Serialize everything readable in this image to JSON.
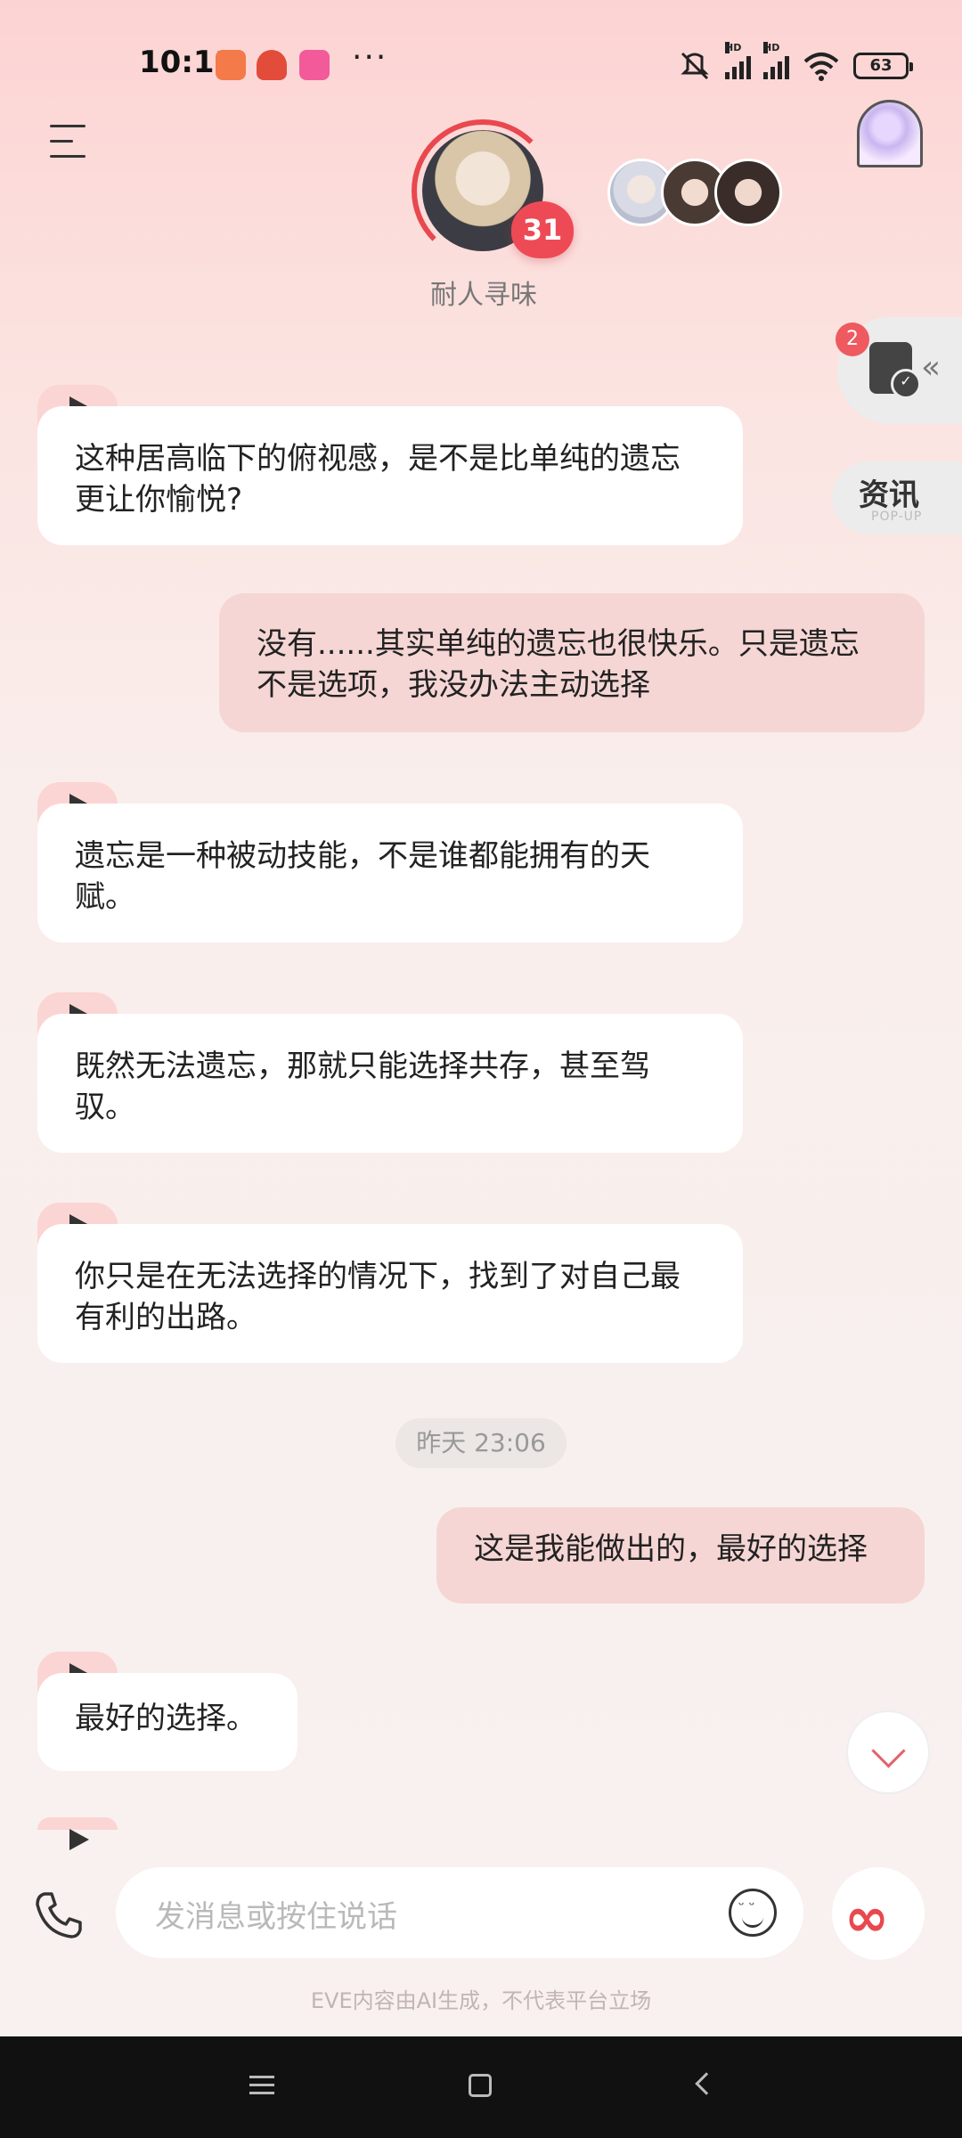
{
  "status_bar": {
    "time": "10:11",
    "battery": "63",
    "more": "···",
    "hd1": "HD",
    "hd2": "HD"
  },
  "header": {
    "character_name": "耐人寻味",
    "affinity_level": "31",
    "menu_icon": "menu-icon",
    "scene_icon": "arch-window-icon"
  },
  "side": {
    "task_badge": "2",
    "news_label": "资讯",
    "news_sub": "POP-UP"
  },
  "messages": [
    {
      "from": "ai",
      "text": "这种居高临下的俯视感，是不是比单纯的遗忘更让你愉悦?"
    },
    {
      "from": "user",
      "text": "没有......其实单纯的遗忘也很快乐。只是遗忘不是选项，我没办法主动选择"
    },
    {
      "from": "ai",
      "text": "遗忘是一种被动技能，不是谁都能拥有的天赋。"
    },
    {
      "from": "ai",
      "text": "既然无法遗忘，那就只能选择共存，甚至驾驭。"
    },
    {
      "from": "ai",
      "text": "你只是在无法选择的情况下，找到了对自己最有利的出路。"
    },
    {
      "from": "user",
      "text": "这是我能做出的，最好的选择"
    },
    {
      "from": "ai",
      "text": "最好的选择。"
    }
  ],
  "timestamp": "昨天 23:06",
  "input": {
    "placeholder": "发消息或按住说话"
  },
  "disclaimer": "EVE内容由AI生成，不代表平台立场",
  "colors": {
    "accent": "#e8484e",
    "user_bubble": "#f5d6d4",
    "ai_bubble": "#ffffff"
  }
}
